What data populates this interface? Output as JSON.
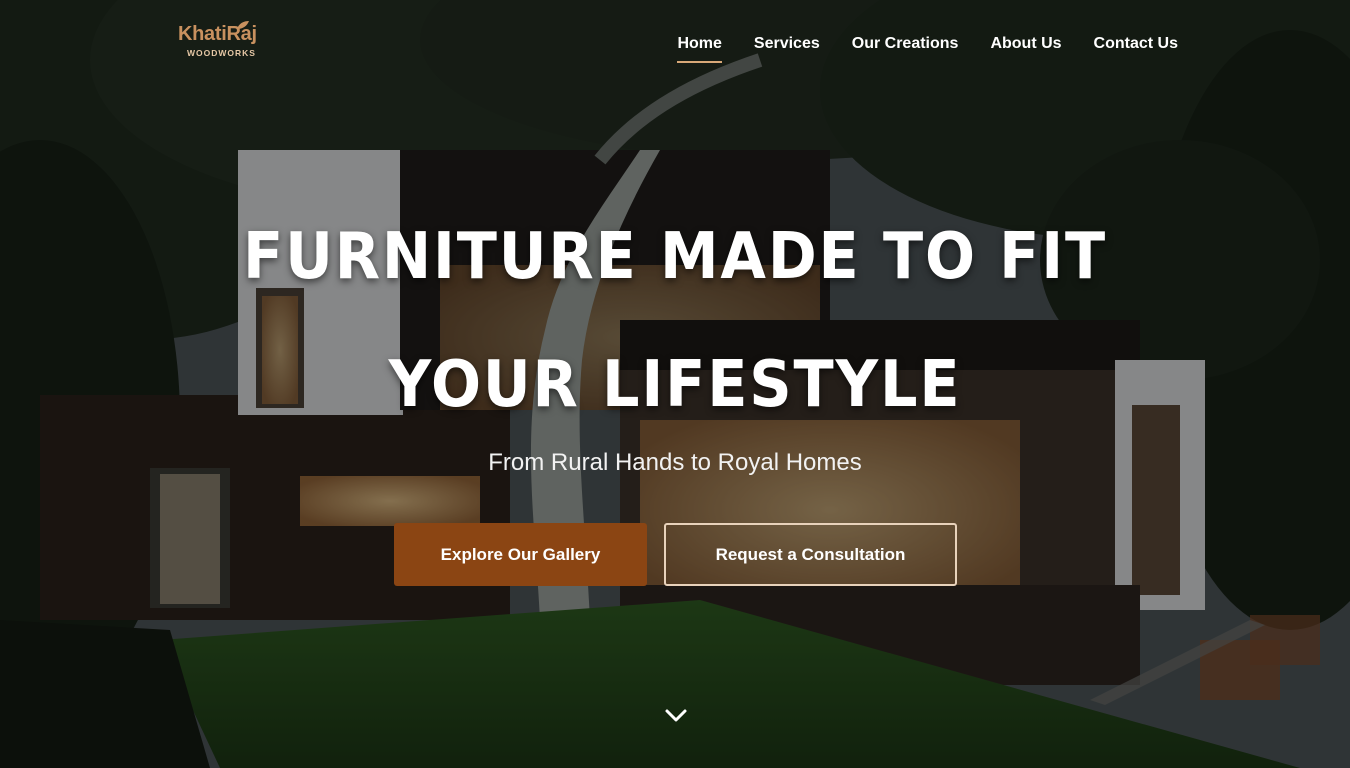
{
  "brand": {
    "name": "KhatiRaj",
    "tagline": "WOODWORKS",
    "logo_color": "#c8915f"
  },
  "nav": {
    "items": [
      {
        "label": "Home",
        "active": true
      },
      {
        "label": "Services",
        "active": false
      },
      {
        "label": "Our Creations",
        "active": false
      },
      {
        "label": "About Us",
        "active": false
      },
      {
        "label": "Contact Us",
        "active": false
      }
    ],
    "active_underline_color": "#d8a878"
  },
  "hero": {
    "headline_line1": "FURNITURE MADE TO FIT",
    "headline_line2": "YOUR LIFESTYLE",
    "subtitle": "From Rural Hands to Royal Homes",
    "primary_cta": "Explore Our Gallery",
    "secondary_cta": "Request a Consultation",
    "primary_color": "#8b4513",
    "scroll_icon": "chevron-down-icon"
  }
}
